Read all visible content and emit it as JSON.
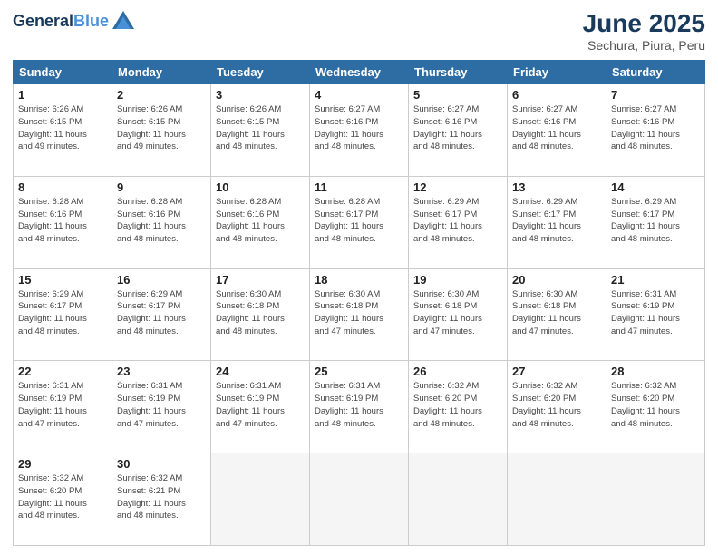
{
  "header": {
    "logo_line1": "General",
    "logo_line2": "Blue",
    "month": "June 2025",
    "location": "Sechura, Piura, Peru"
  },
  "days_of_week": [
    "Sunday",
    "Monday",
    "Tuesday",
    "Wednesday",
    "Thursday",
    "Friday",
    "Saturday"
  ],
  "weeks": [
    [
      {
        "day": "1",
        "info": "Sunrise: 6:26 AM\nSunset: 6:15 PM\nDaylight: 11 hours\nand 49 minutes."
      },
      {
        "day": "2",
        "info": "Sunrise: 6:26 AM\nSunset: 6:15 PM\nDaylight: 11 hours\nand 49 minutes."
      },
      {
        "day": "3",
        "info": "Sunrise: 6:26 AM\nSunset: 6:15 PM\nDaylight: 11 hours\nand 48 minutes."
      },
      {
        "day": "4",
        "info": "Sunrise: 6:27 AM\nSunset: 6:16 PM\nDaylight: 11 hours\nand 48 minutes."
      },
      {
        "day": "5",
        "info": "Sunrise: 6:27 AM\nSunset: 6:16 PM\nDaylight: 11 hours\nand 48 minutes."
      },
      {
        "day": "6",
        "info": "Sunrise: 6:27 AM\nSunset: 6:16 PM\nDaylight: 11 hours\nand 48 minutes."
      },
      {
        "day": "7",
        "info": "Sunrise: 6:27 AM\nSunset: 6:16 PM\nDaylight: 11 hours\nand 48 minutes."
      }
    ],
    [
      {
        "day": "8",
        "info": "Sunrise: 6:28 AM\nSunset: 6:16 PM\nDaylight: 11 hours\nand 48 minutes."
      },
      {
        "day": "9",
        "info": "Sunrise: 6:28 AM\nSunset: 6:16 PM\nDaylight: 11 hours\nand 48 minutes."
      },
      {
        "day": "10",
        "info": "Sunrise: 6:28 AM\nSunset: 6:16 PM\nDaylight: 11 hours\nand 48 minutes."
      },
      {
        "day": "11",
        "info": "Sunrise: 6:28 AM\nSunset: 6:17 PM\nDaylight: 11 hours\nand 48 minutes."
      },
      {
        "day": "12",
        "info": "Sunrise: 6:29 AM\nSunset: 6:17 PM\nDaylight: 11 hours\nand 48 minutes."
      },
      {
        "day": "13",
        "info": "Sunrise: 6:29 AM\nSunset: 6:17 PM\nDaylight: 11 hours\nand 48 minutes."
      },
      {
        "day": "14",
        "info": "Sunrise: 6:29 AM\nSunset: 6:17 PM\nDaylight: 11 hours\nand 48 minutes."
      }
    ],
    [
      {
        "day": "15",
        "info": "Sunrise: 6:29 AM\nSunset: 6:17 PM\nDaylight: 11 hours\nand 48 minutes."
      },
      {
        "day": "16",
        "info": "Sunrise: 6:29 AM\nSunset: 6:17 PM\nDaylight: 11 hours\nand 48 minutes."
      },
      {
        "day": "17",
        "info": "Sunrise: 6:30 AM\nSunset: 6:18 PM\nDaylight: 11 hours\nand 48 minutes."
      },
      {
        "day": "18",
        "info": "Sunrise: 6:30 AM\nSunset: 6:18 PM\nDaylight: 11 hours\nand 47 minutes."
      },
      {
        "day": "19",
        "info": "Sunrise: 6:30 AM\nSunset: 6:18 PM\nDaylight: 11 hours\nand 47 minutes."
      },
      {
        "day": "20",
        "info": "Sunrise: 6:30 AM\nSunset: 6:18 PM\nDaylight: 11 hours\nand 47 minutes."
      },
      {
        "day": "21",
        "info": "Sunrise: 6:31 AM\nSunset: 6:19 PM\nDaylight: 11 hours\nand 47 minutes."
      }
    ],
    [
      {
        "day": "22",
        "info": "Sunrise: 6:31 AM\nSunset: 6:19 PM\nDaylight: 11 hours\nand 47 minutes."
      },
      {
        "day": "23",
        "info": "Sunrise: 6:31 AM\nSunset: 6:19 PM\nDaylight: 11 hours\nand 47 minutes."
      },
      {
        "day": "24",
        "info": "Sunrise: 6:31 AM\nSunset: 6:19 PM\nDaylight: 11 hours\nand 47 minutes."
      },
      {
        "day": "25",
        "info": "Sunrise: 6:31 AM\nSunset: 6:19 PM\nDaylight: 11 hours\nand 48 minutes."
      },
      {
        "day": "26",
        "info": "Sunrise: 6:32 AM\nSunset: 6:20 PM\nDaylight: 11 hours\nand 48 minutes."
      },
      {
        "day": "27",
        "info": "Sunrise: 6:32 AM\nSunset: 6:20 PM\nDaylight: 11 hours\nand 48 minutes."
      },
      {
        "day": "28",
        "info": "Sunrise: 6:32 AM\nSunset: 6:20 PM\nDaylight: 11 hours\nand 48 minutes."
      }
    ],
    [
      {
        "day": "29",
        "info": "Sunrise: 6:32 AM\nSunset: 6:20 PM\nDaylight: 11 hours\nand 48 minutes."
      },
      {
        "day": "30",
        "info": "Sunrise: 6:32 AM\nSunset: 6:21 PM\nDaylight: 11 hours\nand 48 minutes."
      },
      {
        "day": "",
        "info": ""
      },
      {
        "day": "",
        "info": ""
      },
      {
        "day": "",
        "info": ""
      },
      {
        "day": "",
        "info": ""
      },
      {
        "day": "",
        "info": ""
      }
    ]
  ]
}
